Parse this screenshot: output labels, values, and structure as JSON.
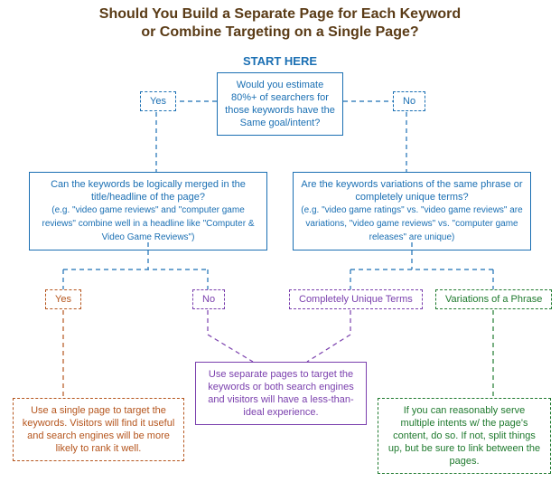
{
  "title_line1": "Should You Build a Separate Page for Each Keyword",
  "title_line2": "or Combine Targeting on a Single Page?",
  "start": "START HERE",
  "root": "Would you estimate 80%+ of searchers for those keywords have the Same goal/intent?",
  "yes": "Yes",
  "no": "No",
  "left_q": "Can the keywords be logically merged in the title/headline of the page?",
  "left_q_sub": "(e.g. \"video game reviews\" and \"computer game reviews\" combine well in a headline like \"Computer & Video Game Reviews\")",
  "right_q": "Are the keywords variations of the same phrase or completely unique terms?",
  "right_q_sub": "(e.g. \"video game ratings\" vs. \"video game reviews\" are variations, \"video game reviews\" vs. \"computer game releases\" are unique)",
  "unique": "Completely Unique Terms",
  "variations": "Variations of a Phrase",
  "end_orange": "Use a single page to target the keywords. Visitors will find it useful and search engines will be more likely to rank it well.",
  "end_purple": "Use separate pages to target the keywords or both search engines and visitors will have a less-than-ideal experience.",
  "end_green": "If you can reasonably serve multiple intents w/ the page's content, do so. If not, split things up, but be sure to link between the pages."
}
